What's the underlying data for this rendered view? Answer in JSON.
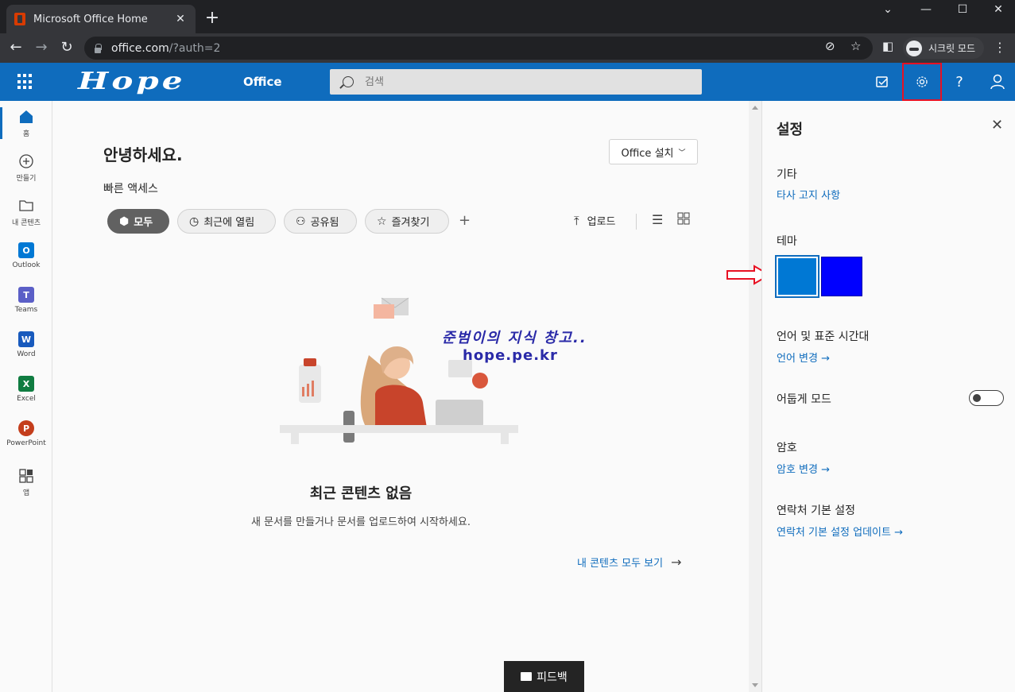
{
  "browser": {
    "tab_title": "Microsoft Office Home",
    "url_host": "office.com",
    "url_path": "/?auth=2",
    "incognito_label": "시크릿 모드"
  },
  "header": {
    "brand": "Hope",
    "product": "Office",
    "search_placeholder": "검색",
    "accent": "#0f6cbd"
  },
  "rail": {
    "items": [
      {
        "label": "홈",
        "icon": "home-icon"
      },
      {
        "label": "만들기",
        "icon": "plus-circle-icon"
      },
      {
        "label": "내 콘텐츠",
        "icon": "folder-icon"
      },
      {
        "label": "Outlook",
        "icon": "outlook-icon"
      },
      {
        "label": "Teams",
        "icon": "teams-icon"
      },
      {
        "label": "Word",
        "icon": "word-icon"
      },
      {
        "label": "Excel",
        "icon": "excel-icon"
      },
      {
        "label": "PowerPoint",
        "icon": "powerpoint-icon"
      },
      {
        "label": "앱",
        "icon": "apps-icon"
      }
    ]
  },
  "main": {
    "greeting": "안녕하세요.",
    "install_label": "Office 설치",
    "quick_access": "빠른 액세스",
    "filters": [
      "모두",
      "최근에 열림",
      "공유됨",
      "즐겨찾기"
    ],
    "upload_label": "업로드",
    "empty_title": "최근 콘텐츠 없음",
    "empty_sub": "새 문서를 만들거나 문서를 업로드하여 시작하세요.",
    "see_all": "내 콘텐츠 모두 보기",
    "watermark_line1": "준범이의 지식 창고..",
    "watermark_line2": "hope.pe.kr",
    "feedback": "피드백"
  },
  "settings": {
    "title": "설정",
    "other_heading": "기타",
    "other_link": "타사 고지 사항",
    "theme_heading": "테마",
    "theme_colors": [
      "#0078d4",
      "#0000ff"
    ],
    "language_heading": "언어 및 표준 시간대",
    "language_link": "언어 변경",
    "dark_mode_label": "어둡게 모드",
    "password_heading": "암호",
    "password_link": "암호 변경",
    "contact_heading": "연락처 기본 설정",
    "contact_link": "연락처 기본 설정 업데이트"
  }
}
